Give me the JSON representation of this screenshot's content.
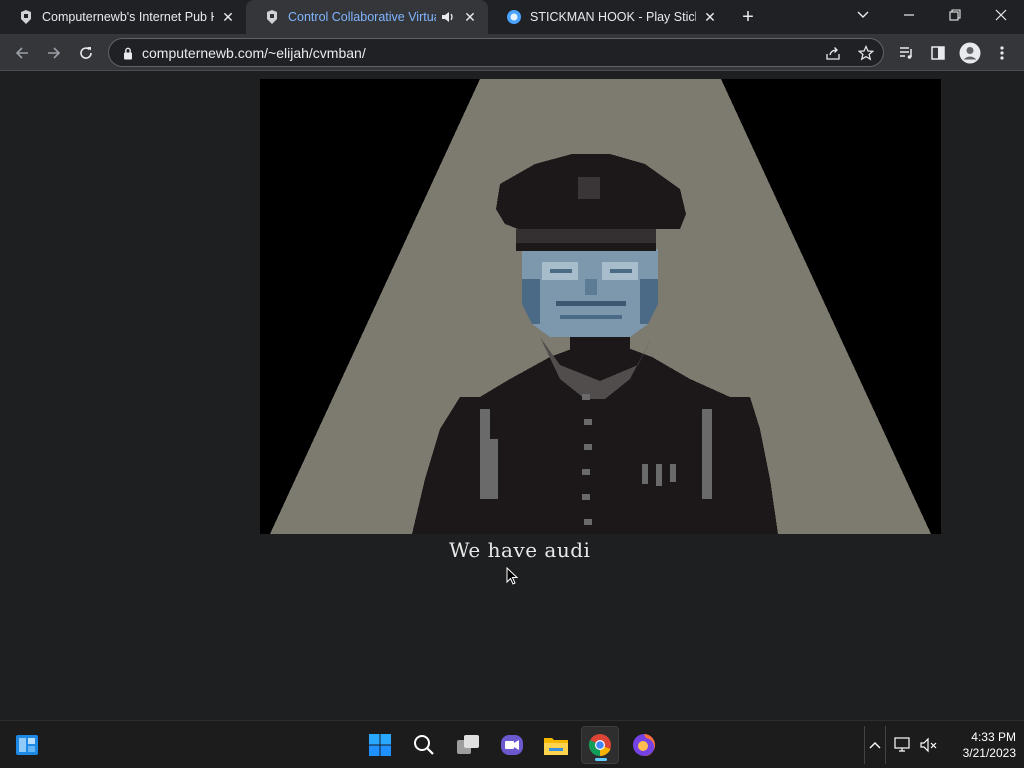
{
  "browser": {
    "tabs": [
      {
        "title": "Computernewb's Internet Pub Hub",
        "favicon": "computernewb-icon",
        "active": false
      },
      {
        "title": "Control Collaborative Virtual Machine",
        "favicon": "computernewb-icon",
        "active": true,
        "audio": true
      },
      {
        "title": "STICKMAN HOOK - Play Stickman Hook",
        "favicon": "stickman-hook-icon",
        "active": false
      }
    ],
    "url": "computernewb.com/~elijah/cvmban/"
  },
  "game": {
    "subtitle": "We have audi",
    "colors": {
      "background": "#000000",
      "spotlight": "#7d7a70",
      "uniform": "#1c1718",
      "face": "#7d97ac",
      "face_shadow": "#4a6a85",
      "accent": "#6d6d6d"
    }
  },
  "taskbar": {
    "apps": [
      "widgets-icon",
      "windows-start-icon",
      "search-icon",
      "task-view-icon",
      "chat-icon",
      "file-explorer-icon",
      "chrome-icon",
      "firefox-icon"
    ],
    "active_app": "chrome-icon",
    "time": "4:33 PM",
    "date": "3/21/2023"
  }
}
